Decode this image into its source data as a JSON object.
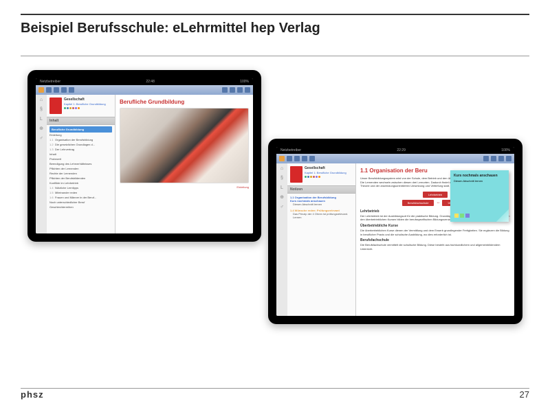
{
  "slide": {
    "title": "Beispiel Berufsschule:  eLehrmittel hep Verlag",
    "brand": "phsz",
    "page_number": "27"
  },
  "tablet1": {
    "status": {
      "carrier": "Netzbetreiber",
      "time": "22:48",
      "battery": "100%"
    },
    "book": {
      "title": "Gesellschaft",
      "chapter": "Kapitel 1: Berufliche Grundbildung"
    },
    "section_header": "Inhalt",
    "toc_selected": "Berufliche Grundbildung",
    "toc_items": [
      {
        "num": "",
        "label": "Einleitung"
      },
      {
        "num": "1.1",
        "label": "Organisation der Berufsbildung"
      },
      {
        "num": "1.2",
        "label": "Die gesetzlichen Grundlagen d..."
      },
      {
        "num": "1.3",
        "label": "Der Lehrvertrag"
      },
      {
        "num": "",
        "label": "Inhalt"
      },
      {
        "num": "",
        "label": "Probezeit"
      },
      {
        "num": "",
        "label": "Beendigung des Lehrverhältnisses"
      },
      {
        "num": "",
        "label": "Pflichten der Lernenden"
      },
      {
        "num": "",
        "label": "Rechte der Lernenden"
      },
      {
        "num": "",
        "label": "Pflichten der Berufsbildenden"
      },
      {
        "num": "",
        "label": "Konflikte im Lehrbetrieb"
      },
      {
        "num": "1.4",
        "label": "Nützliche Lerntipps"
      },
      {
        "num": "1.5",
        "label": "Miteinander reden"
      },
      {
        "num": "1.6",
        "label": "Frauen und Männer in der Beruf..."
      },
      {
        "num": "",
        "label": "Noch unterschiedlicher Beruf"
      },
      {
        "num": "",
        "label": "Geschlechterreihen"
      }
    ],
    "page_title": "Berufliche Grundbildung",
    "bottom_link": "Einleitung"
  },
  "tablet2": {
    "status": {
      "carrier": "Netzbetreiber",
      "time": "22:29",
      "battery": "100%"
    },
    "book": {
      "title": "Gesellschaft",
      "chapter": "Kapitel 1: Berufliche Grundbildung"
    },
    "section_header": "Notizen",
    "notes": [
      {
        "title": "1.1 Organisation der Berufsbildung",
        "subtitle": "Kurs nochmals anschauen",
        "text": "Diesen Abschnitt lernen"
      },
      {
        "title": "1.4 Wünsche reden: Prüfungsrelevant",
        "text": "Das Prinzip der 4 Ohren ist prüfungsrelevant. Lernen"
      }
    ],
    "page_title": "1.1 Organisation der Beru",
    "intro_text": "Unser Berufsbildungssystem wird von der Schule, dem Betrieb und den überbetrieblichen Kursen gemeinsam getragen. Die Lernenden wechseln zwischen diesen drei Lernorten. Dadurch findet ein Wechselspiel zwischen dem Lernen von Theorie und der anwendungsorientierten Umsetzung und Vertiefung statt.",
    "diagram": {
      "top": "Lehrbetrieb",
      "left": "Berufsfachschule",
      "right": "Überbetriebl"
    },
    "sections": [
      {
        "heading": "Lehrbetrieb",
        "text": "Der Lehrbetrieb ist der Ausbildungsort für die praktische Bildung. Grundlage für die praktische Ausbildung im Betrieb und in den überbetrieblichen Kursen bilden die berufsspezifischen Bildungsverordnungen (BiVO)."
      },
      {
        "heading": "Überbetriebliche Kurse",
        "text": "Die überbetrieblichen Kurse dienen der Vermittlung und dem Erwerb grundlegender Fertigkeiten. Sie ergänzen die Bildung in beruflicher Praxis und die schulische Ausbildung, wo dies erforderlich ist."
      },
      {
        "heading": "Berufsfachschule",
        "text": "Die Berufsfachschule vermittelt die schulische Bildung. Diese besteht aus fachkundlichem und allgemeinbildendem Unterricht."
      }
    ],
    "sticky": {
      "title": "Kurs nochmals anschauen",
      "text": "Diesen Abschnitt lernen"
    }
  }
}
